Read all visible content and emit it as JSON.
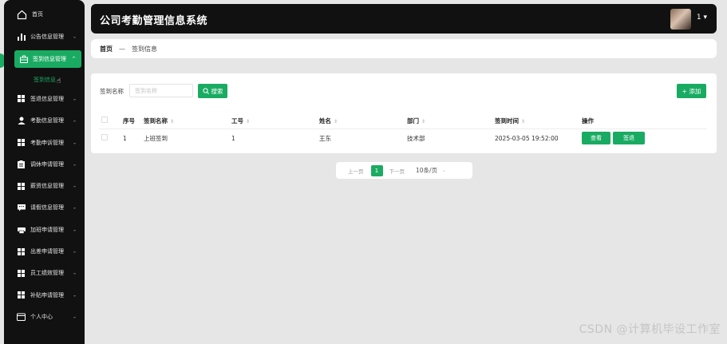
{
  "app": {
    "title": "公司考勤管理信息系统",
    "user": "1",
    "caret": "▾"
  },
  "sidebar": {
    "home": "首页",
    "items": [
      {
        "label": "公告信息管理",
        "icon": "bar-chart-icon"
      },
      {
        "label": "签到信息管理",
        "icon": "briefcase-icon"
      },
      {
        "label": "签退信息管理",
        "icon": "grid-icon"
      },
      {
        "label": "考勤信息管理",
        "icon": "user-icon"
      },
      {
        "label": "考勤申诉管理",
        "icon": "grid-icon"
      },
      {
        "label": "调休申请管理",
        "icon": "clipboard-icon"
      },
      {
        "label": "薪资信息管理",
        "icon": "grid-icon"
      },
      {
        "label": "请假信息管理",
        "icon": "message-icon"
      },
      {
        "label": "加班申请管理",
        "icon": "printer-icon"
      },
      {
        "label": "出差申请管理",
        "icon": "grid-icon"
      },
      {
        "label": "员工绩效管理",
        "icon": "grid-icon"
      },
      {
        "label": "补贴申请管理",
        "icon": "grid-icon"
      },
      {
        "label": "个人中心",
        "icon": "wallet-icon"
      }
    ],
    "sub_item": "签到信息",
    "chevron": "⌄",
    "chevron_up": "^"
  },
  "breadcrumb": {
    "home": "首页",
    "separator": "—",
    "current": "签到信息"
  },
  "search": {
    "label": "签到名称",
    "placeholder": "签到名称",
    "button": "搜索",
    "button_icon": "search-icon"
  },
  "add_button": "+ 添加",
  "table": {
    "headers": [
      "序号",
      "签到名称",
      "工号",
      "姓名",
      "部门",
      "签到时间",
      "操作"
    ],
    "sort_glyph": "⇕",
    "rows": [
      {
        "index": "1",
        "name": "上班签到",
        "emp_no": "1",
        "person": "王东",
        "dept": "技术部",
        "time": "2025-03-05 19:52:00"
      }
    ],
    "actions": {
      "view": "查看",
      "sign_out": "签退"
    }
  },
  "pagination": {
    "prev": "上一页",
    "page": "1",
    "next": "下一页",
    "size": "10条/页",
    "size_chevron": "⌄"
  },
  "watermark": "CSDN @计算机毕设工作室",
  "colors": {
    "accent": "#1aab62",
    "sidebar_bg": "#111111",
    "page_bg": "#e6e6e6"
  }
}
